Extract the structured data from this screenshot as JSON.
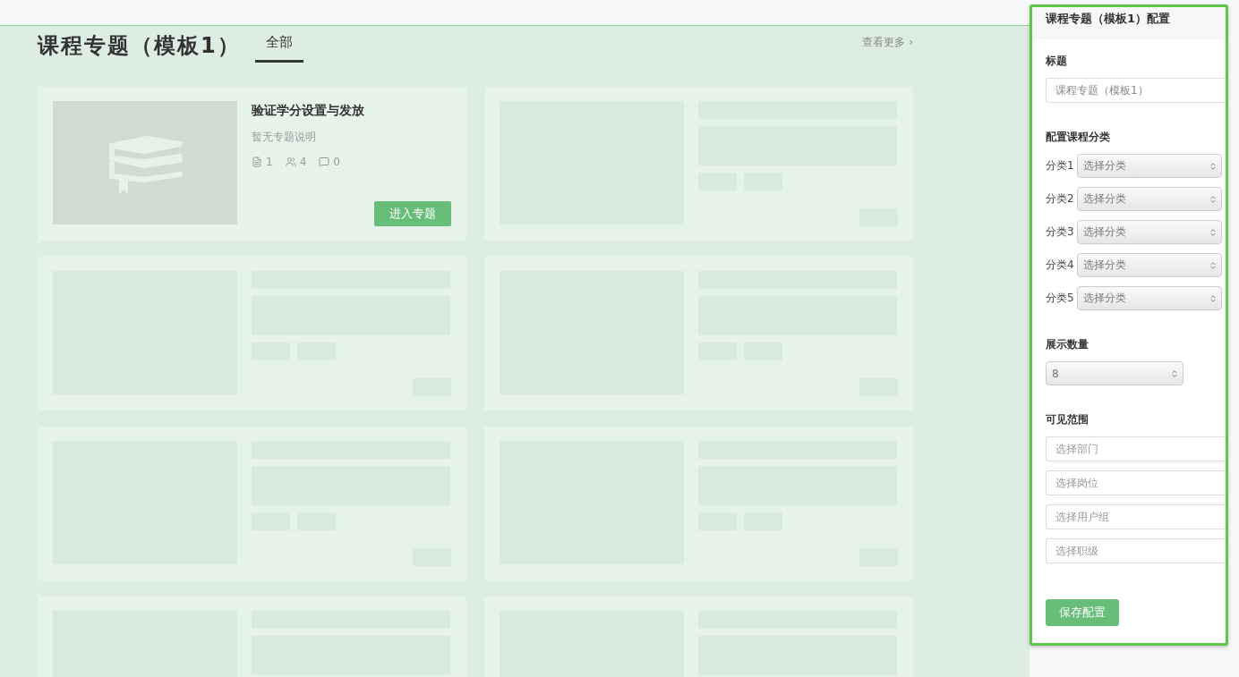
{
  "header": {
    "title": "课程专题（模板1）",
    "tabs": [
      {
        "label": "全部",
        "selected": true
      }
    ],
    "more_link": "查看更多 ›"
  },
  "cards": [
    {
      "kind": "course",
      "title": "验证学分设置与发放",
      "description": "暂无专题说明",
      "stats": [
        {
          "kind": "docs",
          "value": "1"
        },
        {
          "kind": "people",
          "value": "4"
        },
        {
          "kind": "comments",
          "value": "0"
        }
      ],
      "button": "进入专题"
    },
    {
      "kind": "skeleton"
    },
    {
      "kind": "skeleton"
    },
    {
      "kind": "skeleton"
    },
    {
      "kind": "skeleton"
    },
    {
      "kind": "skeleton"
    },
    {
      "kind": "skeleton_partial"
    },
    {
      "kind": "skeleton_partial"
    }
  ],
  "config_panel": {
    "title": "课程专题（模板1）配置",
    "title_section": {
      "label": "标题",
      "value": "课程专题（模板1）"
    },
    "category_section": {
      "label": "配置课程分类",
      "rows": [
        {
          "label": "分类1",
          "placeholder": "选择分类"
        },
        {
          "label": "分类2",
          "placeholder": "选择分类"
        },
        {
          "label": "分类3",
          "placeholder": "选择分类"
        },
        {
          "label": "分类4",
          "placeholder": "选择分类"
        },
        {
          "label": "分类5",
          "placeholder": "选择分类"
        }
      ]
    },
    "count_section": {
      "label": "展示数量",
      "value": "8"
    },
    "visibility_section": {
      "label": "可见范围",
      "fields": [
        {
          "placeholder": "选择部门"
        },
        {
          "placeholder": "选择岗位"
        },
        {
          "placeholder": "选择用户组"
        },
        {
          "placeholder": "选择职级"
        }
      ]
    },
    "save_button": "保存配置"
  }
}
